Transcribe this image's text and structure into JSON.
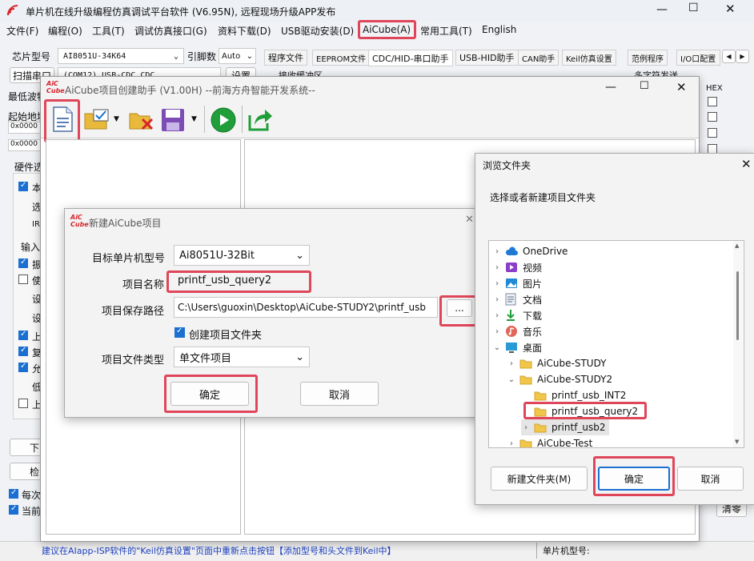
{
  "main": {
    "title": "单片机在线升级编程仿真调试平台软件 (V6.95N), 远程现场升级APP发布",
    "menu": [
      "文件(F)",
      "编程(O)",
      "工具(T)",
      "调试仿真接口(G)",
      "资料下载(D)",
      "USB驱动安装(D)",
      "AiCube(A)",
      "常用工具(T)",
      "English"
    ],
    "chip_label": "芯片型号",
    "chip_value": "AI8051U-34K64",
    "pin_label": "引脚数",
    "pin_value": "Auto",
    "scan_label": "扫描串口",
    "port_value": "(COM12) USB-CDC,CDC",
    "settings_label": "设置",
    "min_baud_label": "最低波特",
    "start_addr_label": "起始地址",
    "addr1": "0x0000",
    "addr2": "0x0000",
    "hw_label": "硬件选",
    "left_opts": [
      "本",
      "选",
      "IR",
      "输入",
      "振",
      "使",
      "设",
      "设",
      "上",
      "复",
      "允",
      "低",
      "上"
    ],
    "download_btn": "下",
    "check_btn": "检",
    "each_time": "每次",
    "current": "当前",
    "tabs": [
      "程序文件",
      "EEPROM文件",
      "CDC/HID-串口助手",
      "USB-HID助手",
      "CAN助手",
      "Keil仿真设置",
      "范例程序",
      "I/O口配置"
    ],
    "recv_buffer": "接收缓冲区",
    "multi_send": "多字符发送",
    "hex_label": "HEX",
    "clear_label": "清零",
    "status_text": "建议在AIapp-ISP软件的\"Keil仿真设置\"页面中重新点击按钮【添加型号和头文件到Keil中】",
    "status_chip": "单片机型号:"
  },
  "helper": {
    "logo": "AiC Cube",
    "title": "AiCube项目创建助手 (V1.00H) --前海方舟智能开发系统--"
  },
  "new_project": {
    "title": "新建AiCube项目",
    "mcu_label": "目标单片机型号",
    "mcu_value": "Ai8051U-32Bit",
    "name_label": "项目名称",
    "name_value": "printf_usb_query2",
    "path_label": "项目保存路径",
    "path_value": "C:\\Users\\guoxin\\Desktop\\AiCube-STUDY2\\printf_usb",
    "browse_label": "...",
    "create_folder_label": "创建项目文件夹",
    "type_label": "项目文件类型",
    "type_value": "单文件项目",
    "ok_label": "确定",
    "cancel_label": "取消"
  },
  "browse": {
    "title": "浏览文件夹",
    "prompt": "选择或者新建项目文件夹",
    "tree": [
      {
        "label": "OneDrive",
        "icon": "cloud-icon",
        "level": 0,
        "arrow": "›"
      },
      {
        "label": "视频",
        "icon": "video-icon",
        "level": 0,
        "arrow": "›"
      },
      {
        "label": "图片",
        "icon": "picture-icon",
        "level": 0,
        "arrow": "›"
      },
      {
        "label": "文档",
        "icon": "document-icon",
        "level": 0,
        "arrow": "›"
      },
      {
        "label": "下载",
        "icon": "download-icon",
        "level": 0,
        "arrow": "›"
      },
      {
        "label": "音乐",
        "icon": "music-icon",
        "level": 0,
        "arrow": "›"
      },
      {
        "label": "桌面",
        "icon": "desktop-icon",
        "level": 0,
        "arrow": "⌄"
      },
      {
        "label": "AiCube-STUDY",
        "icon": "folder-icon",
        "level": 1,
        "arrow": "›"
      },
      {
        "label": "AiCube-STUDY2",
        "icon": "folder-icon",
        "level": 1,
        "arrow": "⌄"
      },
      {
        "label": "printf_usb_INT2",
        "icon": "folder-icon",
        "level": 2,
        "arrow": ""
      },
      {
        "label": "printf_usb_query2",
        "icon": "folder-icon",
        "level": 2,
        "arrow": ""
      },
      {
        "label": "printf_usb2",
        "icon": "folder-icon",
        "level": 2,
        "arrow": "›"
      },
      {
        "label": "AiCube-Test",
        "icon": "folder-icon",
        "level": 1,
        "arrow": "›"
      }
    ],
    "new_folder_label": "新建文件夹(M)",
    "ok_label": "确定",
    "cancel_label": "取消"
  },
  "colors": {
    "accent": "#1a6fd1",
    "highlight": "#e0465a",
    "logo": "#d8232a"
  }
}
